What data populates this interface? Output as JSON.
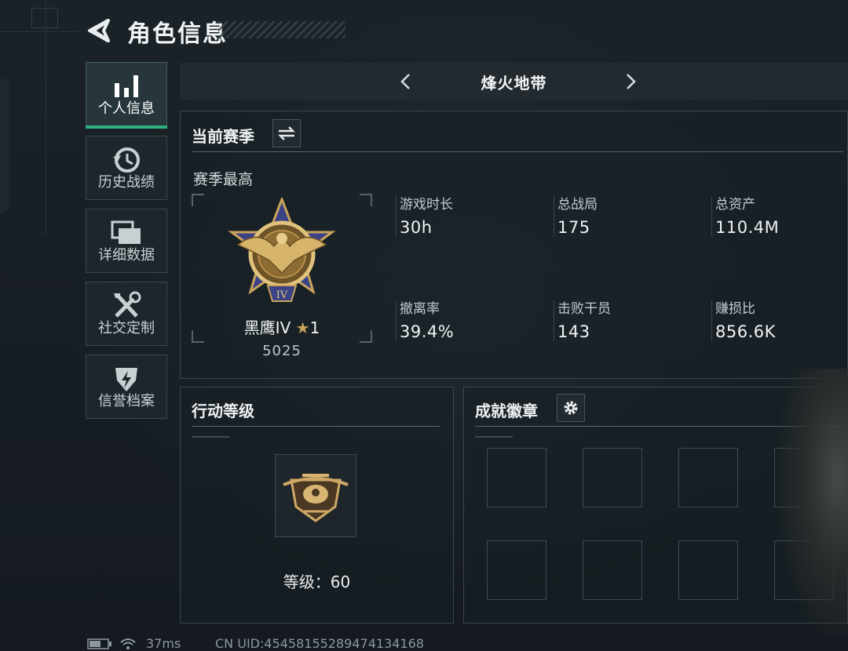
{
  "header": {
    "title": "角色信息"
  },
  "sidebar": {
    "items": [
      {
        "label": "个人信息",
        "icon": "bar-chart-icon",
        "active": true
      },
      {
        "label": "历史战绩",
        "icon": "history-clock-icon",
        "active": false
      },
      {
        "label": "详细数据",
        "icon": "folders-icon",
        "active": false
      },
      {
        "label": "社交定制",
        "icon": "tools-icon",
        "active": false
      },
      {
        "label": "信誉档案",
        "icon": "shield-lightning-icon",
        "active": false
      }
    ]
  },
  "mode": {
    "title": "烽火地带"
  },
  "season": {
    "title": "当前赛季",
    "subtitle": "赛季最高",
    "rank_name": "黑鹰IV",
    "rank_stars": "1",
    "rank_score": "5025",
    "stats": [
      {
        "label": "游戏时长",
        "value": "30h"
      },
      {
        "label": "总战局",
        "value": "175"
      },
      {
        "label": "总资产",
        "value": "110.4M"
      },
      {
        "label": "撤离率",
        "value": "39.4%"
      },
      {
        "label": "击败干员",
        "value": "143"
      },
      {
        "label": "赚损比",
        "value": "856.6K"
      }
    ]
  },
  "action_level": {
    "title": "行动等级",
    "level_text": "等级：60"
  },
  "achievements": {
    "title": "成就徽章"
  },
  "status_bar": {
    "ping": "37ms",
    "uid": "CN UID:4545815528947413416​8"
  },
  "colors": {
    "accent": "#2fb37e",
    "background": "#161c21",
    "panel_border": "#3b464d"
  }
}
